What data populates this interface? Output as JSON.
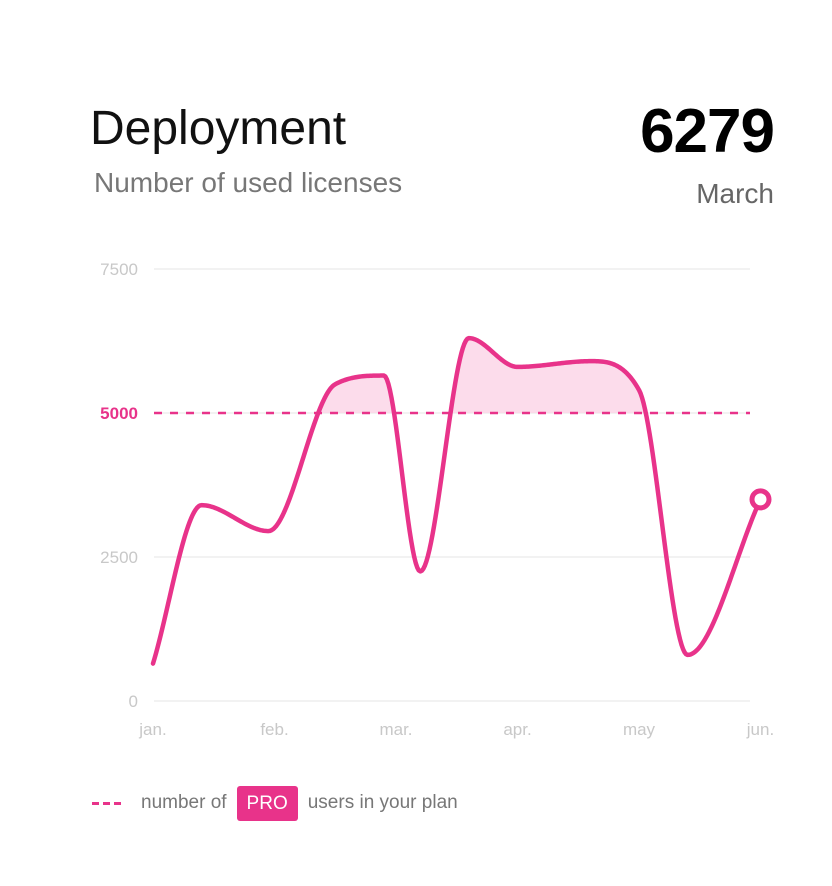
{
  "header": {
    "title": "Deployment",
    "subtitle": "Number of used licenses",
    "highlight_value": "6279",
    "highlight_label": "March"
  },
  "legend": {
    "prefix": "number of",
    "badge": "PRO",
    "suffix": "users in your plan"
  },
  "colors": {
    "accent": "#e8338a",
    "grid": "#f2f2f2",
    "fill": "#fbd3e6"
  },
  "chart_data": {
    "type": "line",
    "x_labels": [
      "jan.",
      "feb.",
      "mar.",
      "apr.",
      "may",
      "jun."
    ],
    "y_ticks": [
      0,
      2500,
      5000,
      7500
    ],
    "ylim": [
      0,
      7500
    ],
    "x": [
      0,
      0.4,
      0.95,
      1.5,
      1.9,
      2.2,
      2.6,
      3.0,
      3.6,
      4.0,
      4.4,
      5.0
    ],
    "values": [
      650,
      3400,
      2950,
      5500,
      5650,
      2250,
      6300,
      5800,
      5900,
      5400,
      800,
      3500
    ],
    "reference_line": 5000,
    "reference_label": "5000",
    "grid": true
  }
}
